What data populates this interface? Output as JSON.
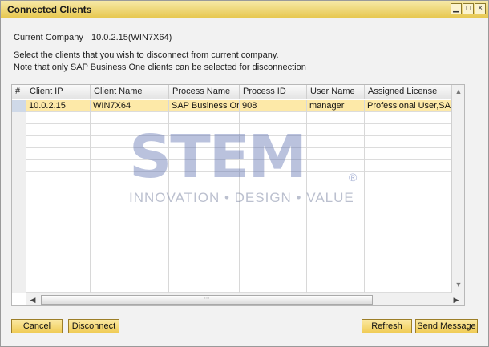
{
  "window": {
    "title": "Connected Clients",
    "controls": {
      "minimize": "▁",
      "maximize": "□",
      "close": "×"
    }
  },
  "info": {
    "company_label": "Current Company",
    "company_value": "10.0.2.15(WIN7X64)",
    "note_line1": "Select the clients that you wish to disconnect from current company.",
    "note_line2": "Note that only SAP Business One clients can be selected for disconnection"
  },
  "grid": {
    "columns": [
      "#",
      "Client IP",
      "Client Name",
      "Process Name",
      "Process ID",
      "User Name",
      "Assigned License"
    ],
    "rows": [
      {
        "num": "",
        "client_ip": "10.0.2.15",
        "client_name": "WIN7X64",
        "process_name": "SAP Business One.exe",
        "process_id": "908",
        "user_name": "manager",
        "assigned_license": "Professional User,SAP Addon"
      }
    ],
    "scroll_grip": ":::"
  },
  "watermark": {
    "brand": "STEM",
    "registered": "®",
    "tagline": "INNOVATION • DESIGN • VALUE"
  },
  "buttons": {
    "cancel": "Cancel",
    "disconnect": "Disconnect",
    "refresh": "Refresh",
    "send_message": "Send Message"
  },
  "colors": {
    "titlebar": "#e7c850",
    "selected_row": "#fde9a8",
    "button": "#f0cc56"
  }
}
